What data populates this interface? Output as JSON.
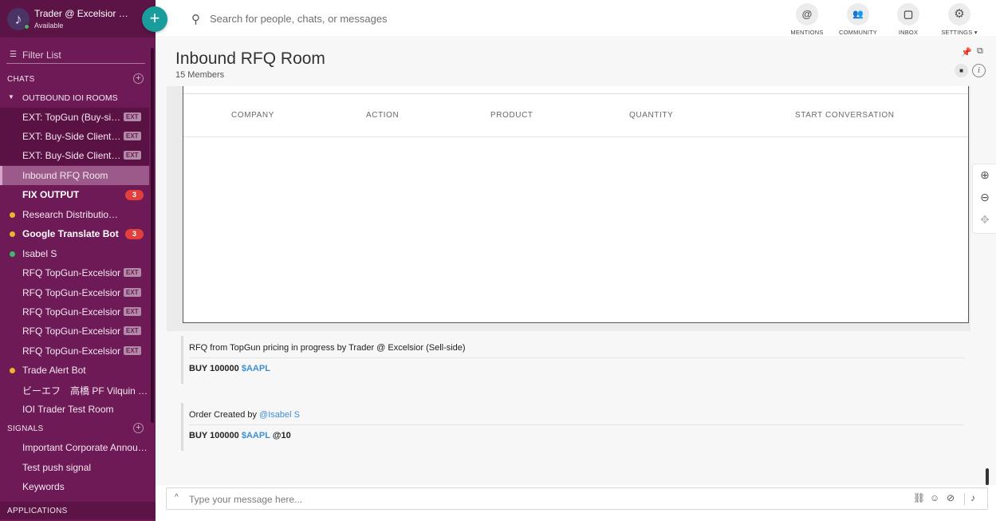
{
  "user": {
    "name": "Trader @ Excelsior (Sell-side)",
    "status": "Available"
  },
  "search": {
    "placeholder": "Search for people, chats, or messages"
  },
  "top_actions": [
    {
      "label": "MENTIONS",
      "glyph": "@"
    },
    {
      "label": "COMMUNITY",
      "glyph": "👥"
    },
    {
      "label": "INBOX",
      "glyph": "▢"
    },
    {
      "label": "SETTINGS ▾",
      "glyph": "⚙"
    }
  ],
  "sidebar": {
    "filter_label": "Filter List",
    "chats_label": "CHATS",
    "group_label": "OUTBOUND IOI ROOMS",
    "items": [
      {
        "label": "EXT: TopGun (Buy-side Client)",
        "badge": "EXT"
      },
      {
        "label": "EXT: Buy-Side Client B (Buy-side)",
        "badge": "EXT"
      },
      {
        "label": "EXT: Buy-Side Client A (Buy-side)",
        "badge": "EXT"
      },
      {
        "label": "Inbound RFQ Room"
      },
      {
        "label": "FIX OUTPUT",
        "count": "3"
      },
      {
        "label": "Research Distribution Bot"
      },
      {
        "label": "Google Translate Bot",
        "count": "3"
      },
      {
        "label": "Isabel S"
      },
      {
        "label": "RFQ TopGun-Excelsior",
        "badge": "EXT"
      },
      {
        "label": "RFQ TopGun-Excelsior",
        "badge": "EXT"
      },
      {
        "label": "RFQ TopGun-Excelsior",
        "badge": "EXT"
      },
      {
        "label": "RFQ TopGun-Excelsior",
        "badge": "EXT"
      },
      {
        "label": "RFQ TopGun-Excelsior",
        "badge": "EXT"
      },
      {
        "label": "Trade Alert Bot"
      },
      {
        "label": "ビーエフ　高橋 PF Vilquin (Buy-side)"
      },
      {
        "label": "IOI Trader Test Room"
      }
    ],
    "signals_label": "SIGNALS",
    "signals": [
      {
        "label": "Important Corporate Annoucements"
      },
      {
        "label": "Test push signal"
      },
      {
        "label": "Keywords"
      }
    ],
    "applications_label": "APPLICATIONS"
  },
  "room": {
    "title": "Inbound RFQ Room",
    "members": "15 Members"
  },
  "grid": {
    "columns": [
      "COMPANY",
      "ACTION",
      "PRODUCT",
      "QUANTITY",
      "START CONVERSATION"
    ]
  },
  "messages": [
    {
      "line1": "RFQ from TopGun pricing in progress by Trader @ Excelsior (Sell-side)",
      "prefix": "BUY 100000 ",
      "ticker": "$AAPL",
      "suffix": ""
    },
    {
      "line1_prefix": "Order Created by ",
      "mention": "@Isabel S",
      "prefix": "BUY 100000 ",
      "ticker": "$AAPL",
      "suffix": " @10"
    }
  ],
  "composer": {
    "placeholder": "Type your message here..."
  },
  "colors": {
    "sidebar": "#6e1a56",
    "accent": "#1a9c9c",
    "badge": "#e2403c",
    "link": "#3a8fd6"
  }
}
